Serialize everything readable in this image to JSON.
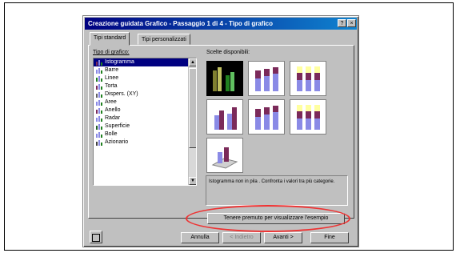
{
  "dialog": {
    "title": "Creazione guidata Grafico - Passaggio 1 di 4 - Tipo di grafico",
    "help_glyph": "?",
    "close_glyph": "×"
  },
  "tabs": [
    {
      "label": "Tipi standard",
      "active": true
    },
    {
      "label": "Tipi personalizzati",
      "active": false
    }
  ],
  "chart_types": {
    "label": "Tipo di grafico:",
    "items": [
      {
        "label": "Istogramma",
        "icon": "column-chart-icon",
        "selected": true
      },
      {
        "label": "Barre",
        "icon": "bar-chart-icon"
      },
      {
        "label": "Linee",
        "icon": "line-chart-icon"
      },
      {
        "label": "Torta",
        "icon": "pie-chart-icon"
      },
      {
        "label": "Dispers. (XY)",
        "icon": "scatter-chart-icon"
      },
      {
        "label": "Aree",
        "icon": "area-chart-icon"
      },
      {
        "label": "Anello",
        "icon": "doughnut-chart-icon"
      },
      {
        "label": "Radar",
        "icon": "radar-chart-icon"
      },
      {
        "label": "Superficie",
        "icon": "surface-chart-icon"
      },
      {
        "label": "Bolle",
        "icon": "bubble-chart-icon"
      },
      {
        "label": "Azionario",
        "icon": "stock-chart-icon"
      }
    ]
  },
  "subtypes": {
    "label": "Scelte disponibili:",
    "count": 7,
    "selected_index": 0
  },
  "description": "Istogramma non in pila . Confronta i valori tra più categorie.",
  "preview_button": "Tenere premuto per visualizzare l'esempio",
  "footer": {
    "cancel": "Annulla",
    "back": "< Indietro",
    "next": "Avanti >",
    "finish": "Fine"
  },
  "colors": {
    "highlight_oval": "#e33333",
    "selection": "#000080",
    "series_a": "#7b2a5a",
    "series_b": "#8a8ae6",
    "series_c": "#ffffa0"
  }
}
